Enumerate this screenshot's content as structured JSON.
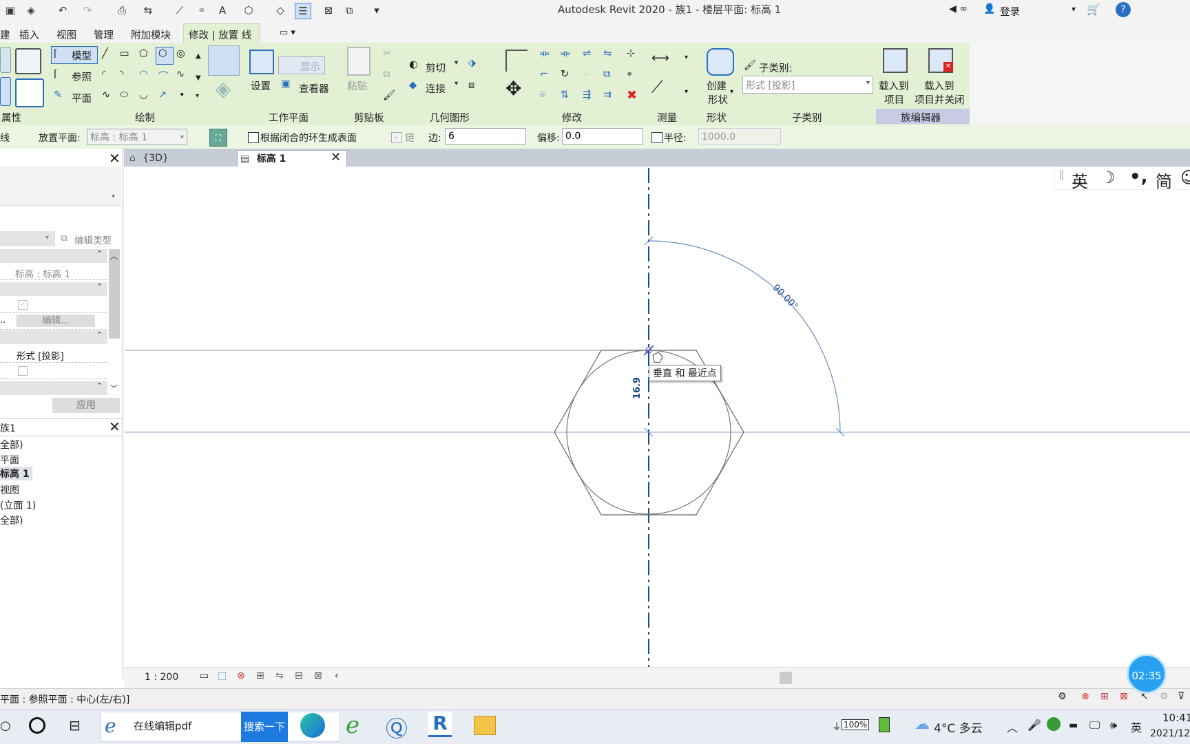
{
  "title": "Autodesk Revit 2020 - 族1 - 楼层平面: 标高 1",
  "topright": {
    "login": "登录",
    "help": "?"
  },
  "menu": [
    "插入",
    "视图",
    "管理",
    "附加模块",
    "修改 | 放置 线"
  ],
  "ribbon": {
    "draw": {
      "model": "模型",
      "ref": "参照",
      "plane": "平面"
    },
    "workplane": {
      "set": "设置",
      "show": "显示",
      "viewer": "查看器"
    },
    "clipboard": {
      "paste": "粘贴"
    },
    "geometry": {
      "cut": "剪切",
      "join": "连接"
    },
    "shape": {
      "create": "创建",
      "create2": "形状"
    },
    "subcategory": {
      "label": "子类别:",
      "value": "形式 [投影]"
    },
    "family": {
      "load": "载入到",
      "load2": "项目",
      "loadclose": "载入到",
      "loadclose2": "项目并关闭"
    },
    "panels": [
      "属性",
      "绘制",
      "工作平面",
      "剪贴板",
      "几何图形",
      "修改",
      "测量",
      "形状",
      "子类别",
      "族编辑器"
    ]
  },
  "options": {
    "left": "线",
    "placement_label": "放置平面:",
    "placement_value": "标高 : 标高 1",
    "closed_loop": "根据闭合的环生成表面",
    "chain": "链",
    "sides_label": "边:",
    "sides_value": "6",
    "offset_label": "偏移:",
    "offset_value": "0.0",
    "radius_label": "半径:",
    "radius_value": "1000.0"
  },
  "properties": {
    "edit_type": "编辑类型",
    "work_plane": "标高 : 标高 1",
    "edit_btn": "编辑...",
    "dots": "..",
    "subcat": "形式 [投影]",
    "apply": "应用"
  },
  "browser": {
    "title": "族1",
    "items": [
      "全部)",
      "平面",
      "标高 1",
      "视图",
      "(立面 1)",
      "全部)"
    ]
  },
  "tabs": [
    {
      "label": "{3D}"
    },
    {
      "label": "标高 1"
    }
  ],
  "canvas": {
    "angle_label": "90.00°",
    "dim_label": "16.9",
    "tooltip": "垂直 和 最近点"
  },
  "ime": {
    "lang": "英",
    "mode": "简"
  },
  "viewbar": {
    "scale": "1 : 200"
  },
  "status": {
    "text": "平面 : 参照平面 : 中心(左/右)]",
    "timer": "02:35"
  },
  "taskbar": {
    "app_label": "在线编辑pdf",
    "search_btn": "搜索一下",
    "battery": "100%",
    "weather": "4°C 多云",
    "lang": "英",
    "time": "10:41",
    "date": "2021/12"
  },
  "colors": {
    "accent": "#2a6fbf",
    "ribbon_active": "#e3f0d4",
    "timer": "#2aa1f0"
  }
}
